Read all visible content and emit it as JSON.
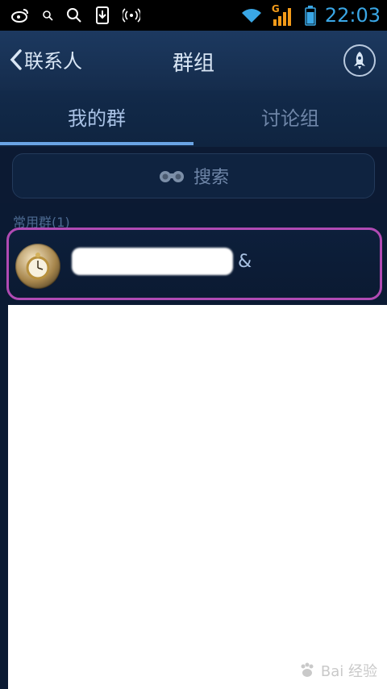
{
  "status_bar": {
    "time": "22:03",
    "signal_label": "G",
    "icons": [
      "weibo-icon",
      "search-small-icon",
      "search-icon",
      "download-icon",
      "wifi-antenna-icon",
      "wifi-icon",
      "signal-icon",
      "battery-icon"
    ]
  },
  "header": {
    "back_label": "联系人",
    "title": "群组",
    "action_icon": "rocket-icon"
  },
  "tabs": [
    {
      "label": "我的群",
      "active": true
    },
    {
      "label": "讨论组",
      "active": false
    }
  ],
  "search": {
    "icon": "binoculars-icon",
    "label": "搜索"
  },
  "section": {
    "label": "常用群(1)"
  },
  "groups": [
    {
      "name_suffix": "&",
      "avatar": "pocket-watch-avatar"
    }
  ],
  "watermark": {
    "text": "Bai 经验"
  },
  "colors": {
    "header_bg": "#1c3960",
    "tab_active": "#aac3e6",
    "tab_inactive": "#6f86a8",
    "tab_underline": "#6aa4e4",
    "highlight_border": "#b04ab3",
    "time_blue": "#3aa7e6",
    "signal_orange": "#f39b19"
  }
}
